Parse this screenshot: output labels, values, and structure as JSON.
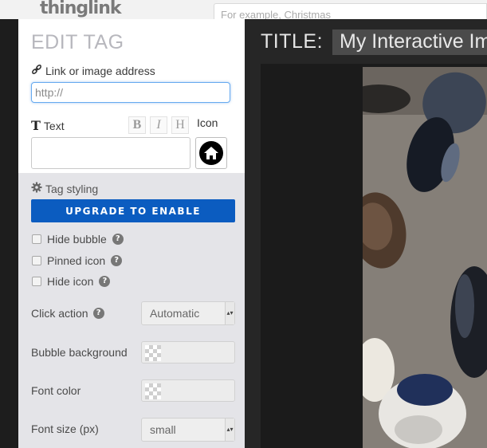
{
  "app": {
    "logo_text": "thinglink",
    "search_placeholder": "For example, Christmas"
  },
  "editor": {
    "title_label": "TITLE:",
    "title_value": "My Interactive Image"
  },
  "panel": {
    "heading": "EDIT TAG",
    "link": {
      "label": "Link or image address",
      "placeholder": "http://",
      "value": ""
    },
    "text": {
      "label": "Text",
      "bold": "B",
      "italic": "I",
      "heading": "H",
      "icon_label": "Icon",
      "value": ""
    },
    "selected_icon": "home-icon",
    "styling": {
      "label": "Tag styling",
      "upgrade_button": "UPGRADE TO ENABLE"
    },
    "options": {
      "hide_bubble": "Hide bubble",
      "pinned_icon": "Pinned icon",
      "hide_icon": "Hide icon"
    },
    "click_action": {
      "label": "Click action",
      "value": "Automatic"
    },
    "bubble_background": {
      "label": "Bubble background"
    },
    "font_color": {
      "label": "Font color"
    },
    "font_size": {
      "label": "Font size (px)",
      "value": "small"
    }
  },
  "colors": {
    "accent": "#0b5cc0",
    "panel_bg": "#e4e4e8",
    "editor_bg": "#262626",
    "focus_border": "#66aaf0"
  }
}
